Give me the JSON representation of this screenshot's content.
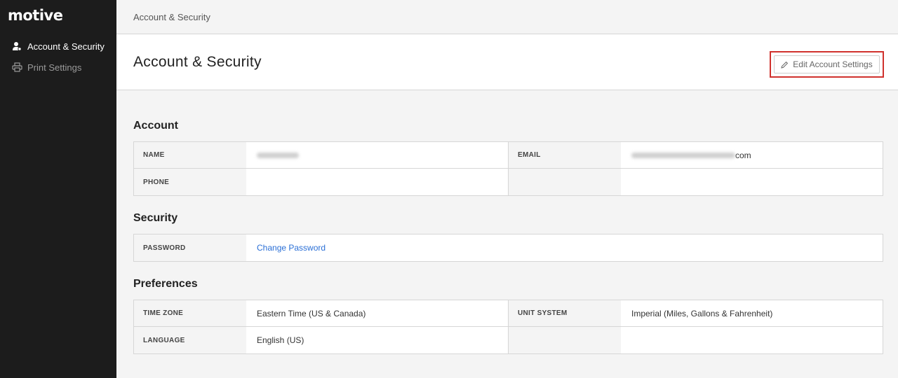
{
  "app": {
    "logo_text": "motive"
  },
  "sidebar": {
    "items": [
      {
        "label": "Account & Security",
        "icon": "user-icon",
        "active": true
      },
      {
        "label": "Print Settings",
        "icon": "printer-icon",
        "active": false
      }
    ]
  },
  "breadcrumb": "Account & Security",
  "header": {
    "title": "Account & Security",
    "edit_button_label": "Edit Account Settings",
    "edit_button_icon": "pencil-icon",
    "highlight_color": "#d0312d"
  },
  "sections": {
    "account": {
      "title": "Account",
      "name_label": "NAME",
      "email_label": "EMAIL",
      "email_suffix": "com",
      "phone_label": "PHONE"
    },
    "security": {
      "title": "Security",
      "password_label": "PASSWORD",
      "password_link": "Change Password"
    },
    "preferences": {
      "title": "Preferences",
      "timezone_label": "TIME ZONE",
      "timezone_value": "Eastern Time (US & Canada)",
      "unit_label": "UNIT SYSTEM",
      "unit_value": "Imperial (Miles, Gallons & Fahrenheit)",
      "language_label": "LANGUAGE",
      "language_value": "English (US)"
    }
  },
  "colors": {
    "sidebar_bg": "#1c1c1c",
    "link": "#2a6fd6",
    "page_bg": "#f4f4f4"
  }
}
